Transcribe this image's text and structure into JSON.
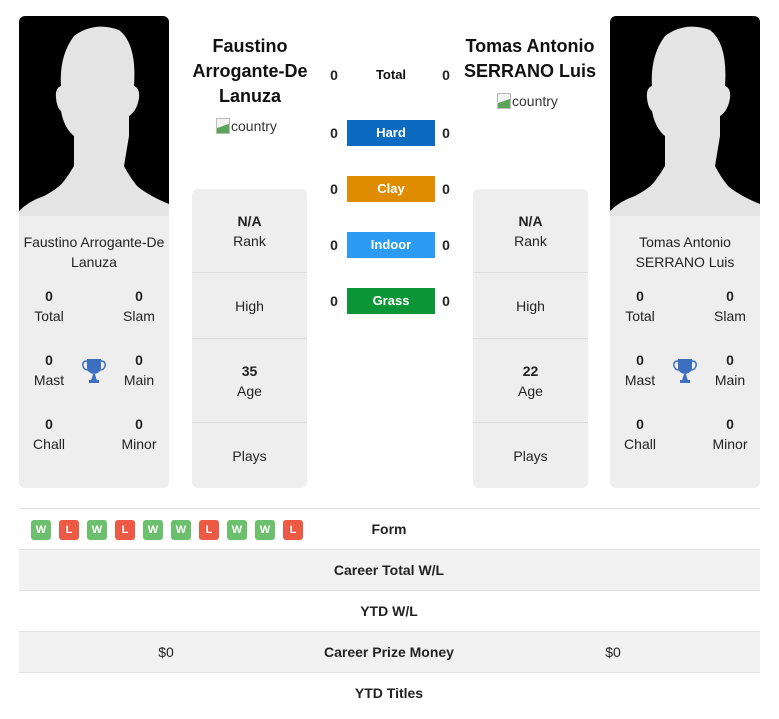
{
  "players": [
    {
      "name": "Faustino Arrogante-De Lanuza",
      "header_name_lines": [
        "Faustino",
        "Arrogante-De",
        "Lanuza"
      ],
      "card_name_lines": [
        "Faustino Arrogante-De",
        "Lanuza"
      ],
      "country_alt": "country",
      "titles": {
        "total": {
          "value": "0",
          "label": "Total"
        },
        "slam": {
          "value": "0",
          "label": "Slam"
        },
        "mast": {
          "value": "0",
          "label": "Mast"
        },
        "main": {
          "value": "0",
          "label": "Main"
        },
        "chall": {
          "value": "0",
          "label": "Chall"
        },
        "minor": {
          "value": "0",
          "label": "Minor"
        }
      },
      "info": {
        "rank_value": "N/A",
        "rank_label": "Rank",
        "high_label": "High",
        "age_value": "35",
        "age_label": "Age",
        "plays_label": "Plays"
      }
    },
    {
      "name": "Tomas Antonio SERRANO Luis",
      "header_name_lines": [
        "Tomas Antonio",
        "SERRANO Luis"
      ],
      "card_name_lines": [
        "Tomas Antonio",
        "SERRANO Luis"
      ],
      "country_alt": "country",
      "titles": {
        "total": {
          "value": "0",
          "label": "Total"
        },
        "slam": {
          "value": "0",
          "label": "Slam"
        },
        "mast": {
          "value": "0",
          "label": "Mast"
        },
        "main": {
          "value": "0",
          "label": "Main"
        },
        "chall": {
          "value": "0",
          "label": "Chall"
        },
        "minor": {
          "value": "0",
          "label": "Minor"
        }
      },
      "info": {
        "rank_value": "N/A",
        "rank_label": "Rank",
        "high_label": "High",
        "age_value": "22",
        "age_label": "Age",
        "plays_label": "Plays"
      }
    }
  ],
  "h2h": [
    {
      "label": "Total",
      "left": "0",
      "right": "0",
      "color": null
    },
    {
      "label": "Hard",
      "left": "0",
      "right": "0",
      "color": "#0b6bc1"
    },
    {
      "label": "Clay",
      "left": "0",
      "right": "0",
      "color": "#df8c00"
    },
    {
      "label": "Indoor",
      "left": "0",
      "right": "0",
      "color": "#2b9bf4"
    },
    {
      "label": "Grass",
      "left": "0",
      "right": "0",
      "color": "#0a9537"
    }
  ],
  "form": [
    "W",
    "L",
    "W",
    "L",
    "W",
    "W",
    "L",
    "W",
    "W",
    "L"
  ],
  "form_colors": {
    "W": "#6cbf6c",
    "L": "#ec5a45"
  },
  "stats": [
    {
      "label": "Form",
      "left": "",
      "right": ""
    },
    {
      "label": "Career Total W/L",
      "left": "",
      "right": ""
    },
    {
      "label": "YTD W/L",
      "left": "",
      "right": ""
    },
    {
      "label": "Career Prize Money",
      "left": "$0",
      "right": "$0"
    },
    {
      "label": "YTD Titles",
      "left": "",
      "right": ""
    }
  ]
}
